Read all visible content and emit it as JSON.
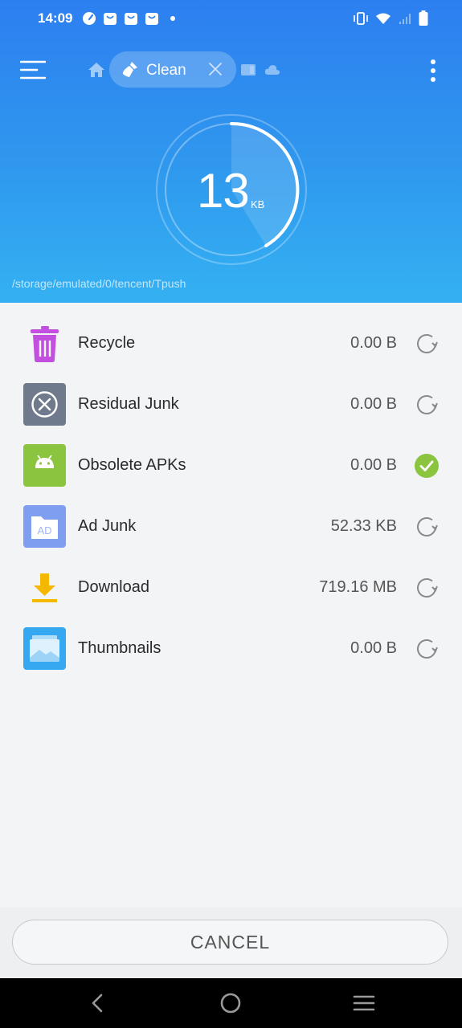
{
  "status_bar": {
    "time": "14:09",
    "notification_icons": [
      "speedometer-icon",
      "bag-icon",
      "bag-icon",
      "bag-icon",
      "dot-icon"
    ],
    "system_icons": [
      "vibrate-icon",
      "wifi-icon",
      "signal-icon",
      "battery-icon"
    ]
  },
  "toolbar": {
    "tab_label": "Clean",
    "icons": [
      "menu-icon",
      "home-icon",
      "broom-icon",
      "close-icon",
      "window-icon",
      "cloud-icon",
      "more-vert-icon"
    ]
  },
  "gauge": {
    "value": "13",
    "unit": "KB"
  },
  "scan_path": "/storage/emulated/0/tencent/Tpush",
  "items": [
    {
      "label": "Recycle",
      "size": "0.00 B",
      "status": "scanning",
      "icon": "trash-icon"
    },
    {
      "label": "Residual Junk",
      "size": "0.00 B",
      "status": "scanning",
      "icon": "residual-x-icon"
    },
    {
      "label": "Obsolete APKs",
      "size": "0.00 B",
      "status": "done",
      "icon": "android-icon"
    },
    {
      "label": "Ad Junk",
      "size": "52.33 KB",
      "status": "scanning",
      "icon": "ad-icon"
    },
    {
      "label": "Download",
      "size": "719.16 MB",
      "status": "scanning",
      "icon": "download-icon"
    },
    {
      "label": "Thumbnails",
      "size": "0.00 B",
      "status": "scanning",
      "icon": "image-icon"
    }
  ],
  "cancel_label": "CANCEL",
  "colors": {
    "header_top": "#2d7ff0",
    "header_bottom": "#34b1f2",
    "done_green": "#8bc53f",
    "recycle_purple": "#c24fe0",
    "residual_gray": "#6f7a8c",
    "android_green": "#8bc53f",
    "ad_blue": "#7e9ff0",
    "download_orange": "#f5b800",
    "thumb_blue": "#35a8f1"
  }
}
